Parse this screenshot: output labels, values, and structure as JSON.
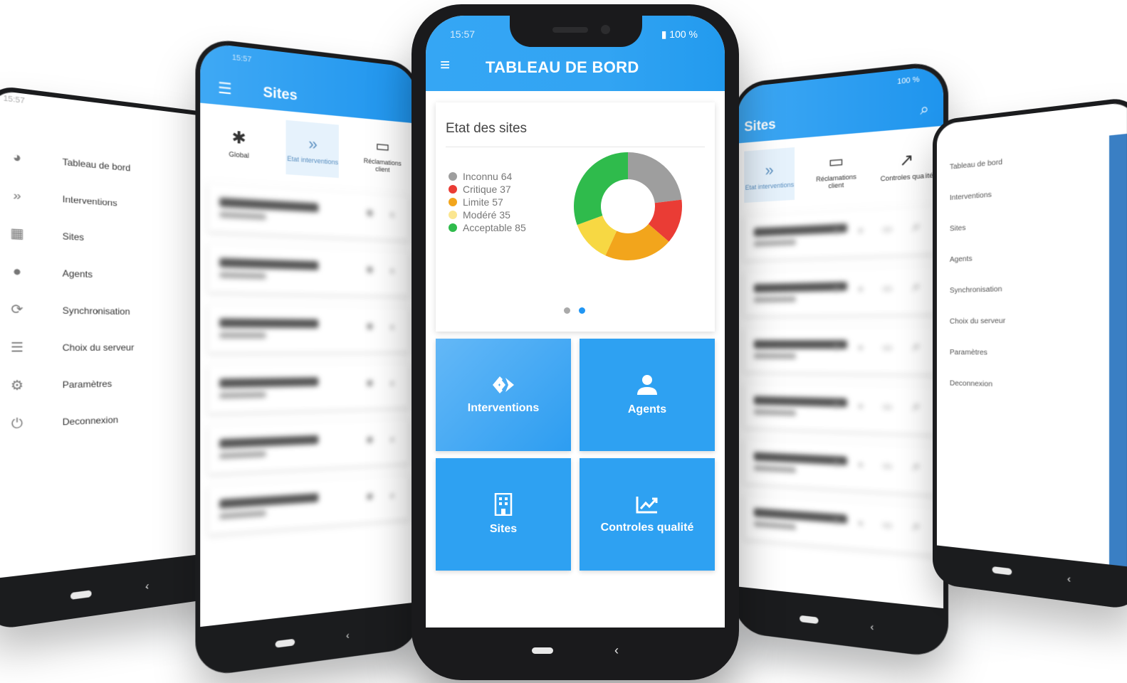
{
  "left_drawer": {
    "time": "15:57",
    "items": [
      {
        "icon": "pie-chart-icon",
        "glyph": "◕",
        "label": "Tableau de bord"
      },
      {
        "icon": "interventions-icon",
        "glyph": "»",
        "label": "Interventions"
      },
      {
        "icon": "building-icon",
        "glyph": "▦",
        "label": "Sites"
      },
      {
        "icon": "person-icon",
        "glyph": "●",
        "label": "Agents"
      },
      {
        "icon": "sync-icon",
        "glyph": "⟳",
        "label": "Synchronisation"
      },
      {
        "icon": "server-icon",
        "glyph": "☰",
        "label": "Choix du serveur"
      },
      {
        "icon": "gears-icon",
        "glyph": "⚙",
        "label": "Paramètres"
      },
      {
        "icon": "power-icon",
        "glyph": "⏻",
        "label": "Deconnexion"
      }
    ]
  },
  "sites_left": {
    "time": "15:57",
    "title": "Sites",
    "tabs": [
      {
        "label": "Global",
        "glyph": "✱"
      },
      {
        "label": "Etat interventions",
        "glyph": "»"
      },
      {
        "label": "Réclamations client",
        "glyph": "▭"
      }
    ]
  },
  "sites_right": {
    "battery": "100 %",
    "title": "Sites",
    "tabs": [
      {
        "label": "Etat interventions",
        "glyph": "»"
      },
      {
        "label": "Réclamations client",
        "glyph": "▭"
      },
      {
        "label": "Controles qualité",
        "glyph": "↗"
      }
    ]
  },
  "right_drawer": {
    "items": [
      "Tableau de bord",
      "Interventions",
      "Sites",
      "Agents",
      "Synchronisation",
      "Choix du serveur",
      "Paramètres",
      "Deconnexion"
    ]
  },
  "main": {
    "time": "15:57",
    "battery": "100 %",
    "title": "TABLEAU DE BORD",
    "card_title": "Etat des sites",
    "legend": [
      {
        "label": "Inconnu 64"
      },
      {
        "label": "Critique 37"
      },
      {
        "label": "Limite 57"
      },
      {
        "label": "Modéré 35"
      },
      {
        "label": "Acceptable 85"
      }
    ],
    "tiles": {
      "interventions": "Interventions",
      "agents": "Agents",
      "sites": "Sites",
      "controles": "Controles qualité"
    }
  },
  "chart_data": {
    "type": "pie",
    "categories": [
      "Inconnu",
      "Critique",
      "Limite",
      "Modéré",
      "Acceptable"
    ],
    "values": [
      64,
      37,
      57,
      35,
      85
    ],
    "colors": [
      "#9e9e9e",
      "#ea3c35",
      "#f2a51c",
      "#f7d843",
      "#2fbb4c"
    ],
    "donut": true,
    "title": "Etat des sites"
  },
  "colors": {
    "accent": "#2ea1f2",
    "header": "#35a6f4",
    "active_dot": "#2196f3"
  }
}
